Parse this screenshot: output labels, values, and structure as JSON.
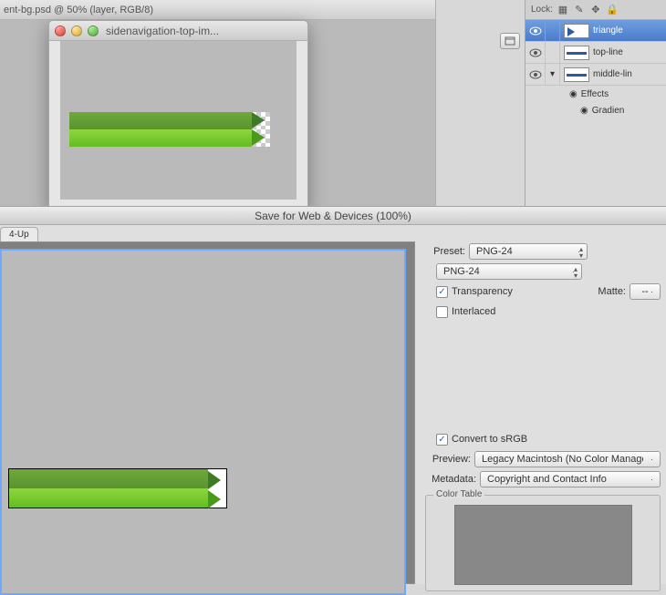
{
  "back_window": {
    "title": "ent-bg.psd @ 50% (layer, RGB/8)"
  },
  "front_window": {
    "title": "sidenavigation-top-im..."
  },
  "layers_panel": {
    "lock_label": "Lock:",
    "layers": [
      {
        "name": "triangle"
      },
      {
        "name": "top-line"
      },
      {
        "name": "middle-lin"
      }
    ],
    "effects_label": "Effects",
    "gradient_label": "Gradien"
  },
  "save_for_web": {
    "title": "Save for Web & Devices (100%)",
    "tab_4up": "4-Up",
    "preset_label": "Preset:",
    "preset_value": "PNG-24",
    "format_value": "PNG-24",
    "transparency_label": "Transparency",
    "matte_label": "Matte:",
    "matte_value": "--",
    "interlaced_label": "Interlaced",
    "convert_srgb_label": "Convert to sRGB",
    "preview_label": "Preview:",
    "preview_value": "Legacy Macintosh (No Color Manage...",
    "metadata_label": "Metadata:",
    "metadata_value": "Copyright and Contact Info",
    "color_table_label": "Color Table"
  }
}
